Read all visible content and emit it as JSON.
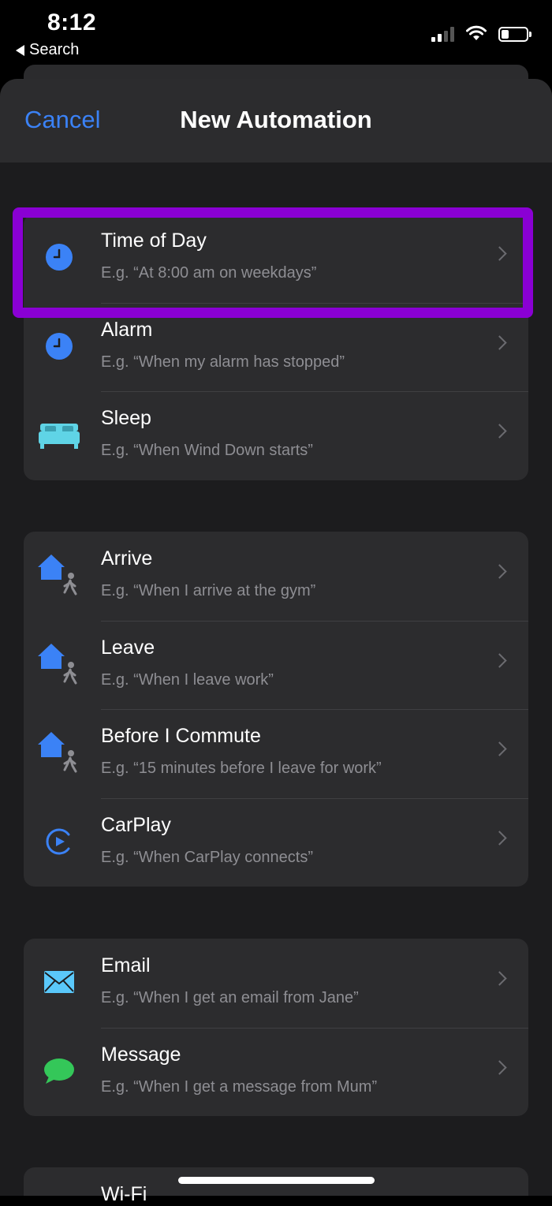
{
  "status_bar": {
    "time": "8:12",
    "back_label": "Search"
  },
  "nav": {
    "cancel_label": "Cancel",
    "title": "New Automation"
  },
  "groups": [
    {
      "items": [
        {
          "title": "Time of Day",
          "subtitle": "E.g. “At 8:00 am on weekdays”",
          "icon": "clock-icon"
        },
        {
          "title": "Alarm",
          "subtitle": "E.g. “When my alarm has stopped”",
          "icon": "clock-icon"
        },
        {
          "title": "Sleep",
          "subtitle": "E.g. “When Wind Down starts”",
          "icon": "bed-icon"
        }
      ]
    },
    {
      "items": [
        {
          "title": "Arrive",
          "subtitle": "E.g. “When I arrive at the gym”",
          "icon": "home-person-icon"
        },
        {
          "title": "Leave",
          "subtitle": "E.g. “When I leave work”",
          "icon": "home-person-icon"
        },
        {
          "title": "Before I Commute",
          "subtitle": "E.g. “15 minutes before I leave for work”",
          "icon": "home-person-icon"
        },
        {
          "title": "CarPlay",
          "subtitle": "E.g. “When CarPlay connects”",
          "icon": "carplay-icon"
        }
      ]
    },
    {
      "items": [
        {
          "title": "Email",
          "subtitle": "E.g. “When I get an email from Jane”",
          "icon": "envelope-icon"
        },
        {
          "title": "Message",
          "subtitle": "E.g. “When I get a message from Mum”",
          "icon": "message-bubble-icon"
        }
      ]
    },
    {
      "items": [
        {
          "title": "Wi-Fi"
        }
      ]
    }
  ],
  "colors": {
    "accent": "#3b82f6",
    "highlight": "#8a00d4",
    "sleep": "#5fd4e6",
    "mail": "#5ac8fa",
    "message": "#34c759"
  }
}
